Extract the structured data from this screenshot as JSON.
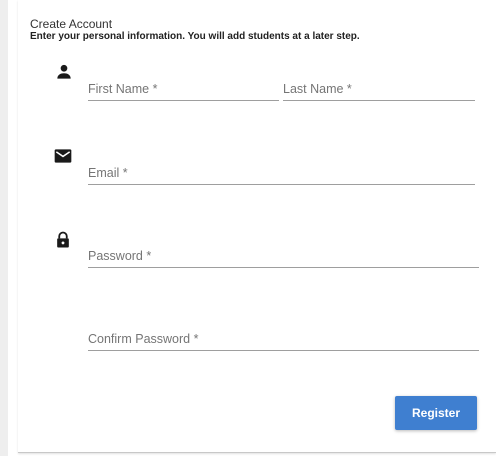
{
  "card": {
    "title": "Create Account",
    "subtitle": "Enter your personal information.  You will add students at a later step."
  },
  "fields": {
    "first_name": {
      "placeholder": "First Name *",
      "value": ""
    },
    "last_name": {
      "placeholder": "Last Name *",
      "value": ""
    },
    "email": {
      "placeholder": "Email *",
      "value": ""
    },
    "password": {
      "placeholder": "Password *",
      "value": ""
    },
    "confirm_password": {
      "placeholder": "Confirm Password *",
      "value": ""
    }
  },
  "icons": {
    "name": "person-icon",
    "email": "envelope-icon",
    "password": "lock-icon"
  },
  "actions": {
    "register_label": "Register"
  },
  "colors": {
    "accent": "#3f7fd0",
    "icon": "#1a1a1a",
    "underline": "#9e9e9e",
    "placeholder": "#757575"
  }
}
